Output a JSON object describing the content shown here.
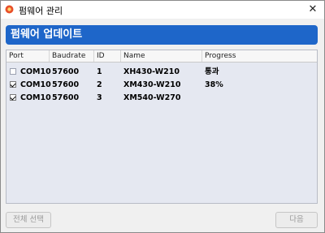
{
  "window": {
    "title": "펌웨어 관리",
    "close_glyph": "✕",
    "app_icon": "gear-flame-icon"
  },
  "banner": {
    "title": "펌웨어 업데이트",
    "color": "#1e66c9"
  },
  "table": {
    "columns": [
      "Port",
      "Baudrate",
      "ID",
      "Name",
      "Progress"
    ],
    "rows": [
      {
        "checked": false,
        "port": "COM10",
        "baudrate": "57600",
        "id": "1",
        "name": "XH430-W210",
        "progress": "통과"
      },
      {
        "checked": true,
        "port": "COM10",
        "baudrate": "57600",
        "id": "2",
        "name": "XM430-W210",
        "progress": "38%"
      },
      {
        "checked": true,
        "port": "COM10",
        "baudrate": "57600",
        "id": "3",
        "name": "XM540-W270",
        "progress": ""
      }
    ]
  },
  "footer": {
    "select_all_label": "전체 선택",
    "next_label": "다음"
  }
}
